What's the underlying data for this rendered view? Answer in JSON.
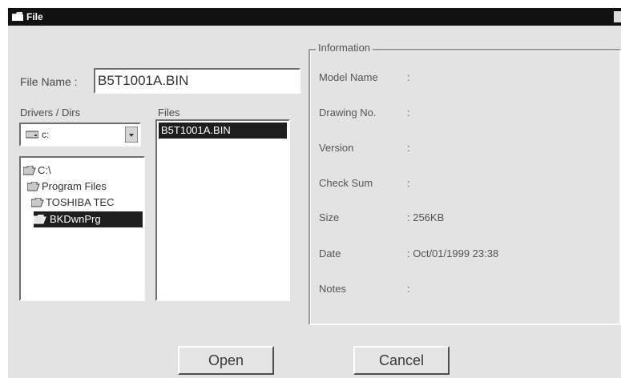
{
  "window": {
    "title": "File",
    "title_icon": "folder-icon",
    "colors": {
      "titlebar": "#111111",
      "face": "#e3e3e3",
      "selection": "#1e1e1e"
    }
  },
  "file_name": {
    "label": "File Name :",
    "value": "B5T1001A.BIN"
  },
  "drivers": {
    "label": "Drivers / Dirs",
    "selected": "c:",
    "icon": "hard-drive-icon"
  },
  "dir_tree": [
    {
      "label": "C:\\",
      "icon": "open-folder-icon",
      "selected": false
    },
    {
      "label": "Program Files",
      "icon": "open-folder-icon",
      "selected": false
    },
    {
      "label": "TOSHIBA TEC",
      "icon": "open-folder-icon",
      "selected": false
    },
    {
      "label": "BKDwnPrg",
      "icon": "open-folder-icon",
      "selected": true
    }
  ],
  "files": {
    "label": "Files",
    "items": [
      "B5T1001A.BIN"
    ],
    "selected": "B5T1001A.BIN"
  },
  "information": {
    "title": "Information",
    "fields": [
      {
        "label": "Model Name",
        "value": ":"
      },
      {
        "label": "Drawing No.",
        "value": ":"
      },
      {
        "label": "Version",
        "value": ":"
      },
      {
        "label": "Check Sum",
        "value": ":"
      },
      {
        "label": "Size",
        "value": ": 256KB"
      },
      {
        "label": "Date",
        "value": ": Oct/01/1999 23:38"
      },
      {
        "label": "Notes",
        "value": ":"
      }
    ]
  },
  "buttons": {
    "open": "Open",
    "cancel": "Cancel"
  }
}
